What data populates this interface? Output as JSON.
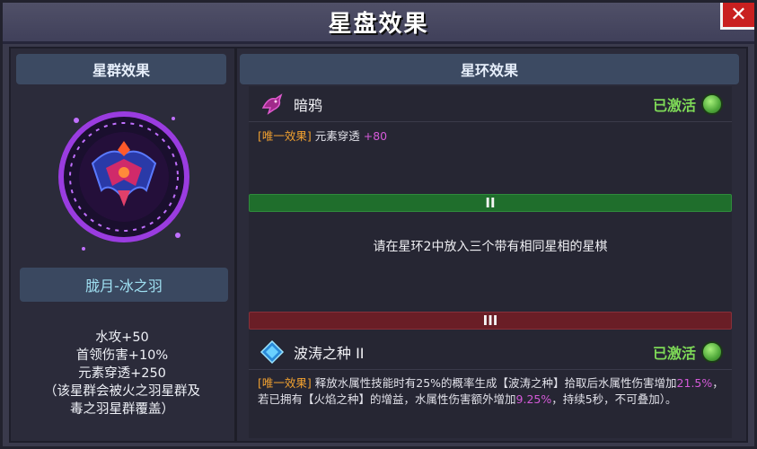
{
  "window": {
    "title": "星盘效果",
    "close_label": "✕"
  },
  "left_panel": {
    "header": "星群效果",
    "constellation_name": "胧月-冰之羽",
    "stats": [
      "水攻+50",
      "首领伤害+10%",
      "元素穿透+250",
      "（该星群会被火之羽星群及",
      "毒之羽星群覆盖）"
    ]
  },
  "right_panel": {
    "header": "星环效果",
    "rings": [
      {
        "name": "暗鸦",
        "icon": "raven-icon",
        "status": "已激活",
        "desc_tag": "[唯一效果]",
        "desc_text": "元素穿透",
        "desc_value": "+80"
      }
    ],
    "ring2": {
      "label": "II",
      "placeholder": "请在星环2中放入三个带有相同星相的星棋"
    },
    "ring3": {
      "label": "III",
      "name": "波涛之种 II",
      "icon": "diamond-icon",
      "status": "已激活",
      "desc_tag": "[唯一效果]",
      "desc_part1": "释放水属性技能时有25%的概率生成【波涛之种】拾取后水属性伤害增加",
      "desc_value1": "21.5%",
      "desc_part2": "，若已拥有【火焰之种】的增益，水属性伤害额外增加",
      "desc_value2": "9.25%",
      "desc_part3": "，持续5秒，不可叠加）。"
    }
  },
  "colors": {
    "active_green": "#7ed957",
    "tag_orange": "#f0a030",
    "value_purple": "#d45ad8",
    "ring2_bar": "#1f6e2c",
    "ring3_bar": "#6a1e26"
  }
}
